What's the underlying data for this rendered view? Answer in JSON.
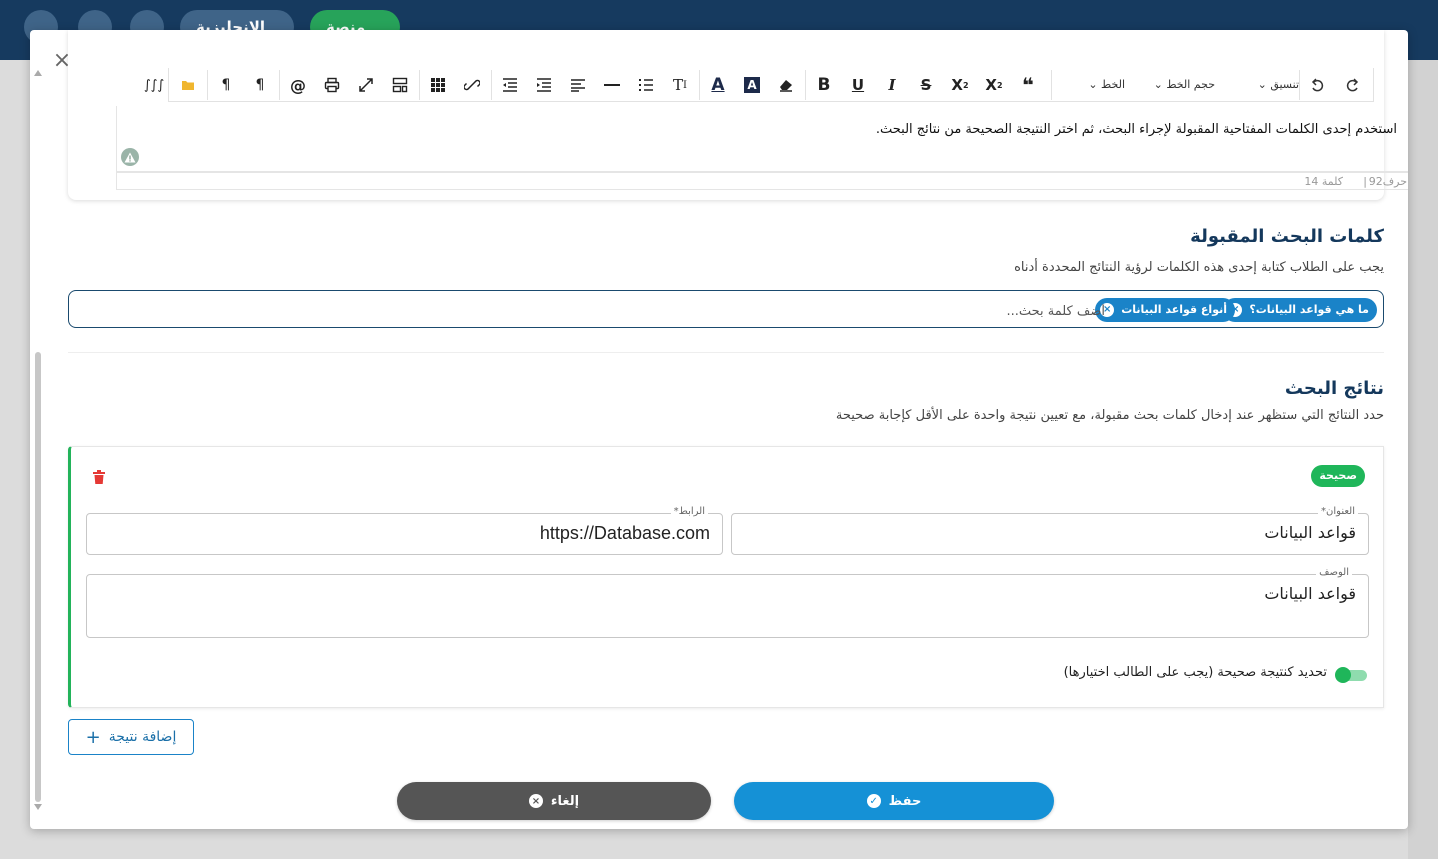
{
  "app": {
    "top_pills": [
      "الإنجليزية",
      "منصة"
    ]
  },
  "toolbar": {
    "format_label": "تنسيق",
    "font_size_label": "حجم الخط",
    "font_label": "الخط",
    "buttons": [
      "undo-icon",
      "redo-icon",
      "quote-icon",
      "superscript-icon",
      "subscript-icon",
      "strike-icon",
      "italic-icon",
      "underline-icon",
      "bold-icon",
      "eraser-icon",
      "bg-color-icon",
      "font-color-icon",
      "text-size-icon",
      "ordered-list-icon",
      "hr-icon",
      "align-icon",
      "outdent-icon",
      "indent-icon",
      "unlink-icon",
      "table-icon",
      "template-icon",
      "fullscreen-icon",
      "print-icon",
      "mention-icon",
      "rtl-icon",
      "ltr-icon",
      "folder-icon",
      "math-icon"
    ]
  },
  "editor": {
    "text": "استخدم إحدى الكلمات المفتاحية المقبولة لإجراء البحث، ثم اختر النتيجة الصحيحة من نتائج البحث.",
    "char_count": "حرف92",
    "separator": "|",
    "word_count": "كلمة 14"
  },
  "keywords": {
    "title": "كلمات البحث المقبولة",
    "description": "يجب على الطلاب كتابة إحدى هذه الكلمات لرؤية النتائج المحددة أدناه",
    "chips": [
      "ما هي قواعد البيانات؟",
      "أنواع قواعد البيانات"
    ],
    "chip_close": "×",
    "placeholder": "أضف كلمة بحث..."
  },
  "results": {
    "title": "نتائج البحث",
    "description": "حدد النتائج التي ستظهر عند إدخال كلمات بحث مقبولة، مع تعيين نتيجة واحدة على الأقل كإجابة صحيحة",
    "items": [
      {
        "badge": "صحيحة",
        "title_label": "العنوان*",
        "title_value": "قواعد البيانات",
        "link_label": "الرابط*",
        "link_value": "https://Database.com",
        "desc_label": "الوصف",
        "desc_value": "قواعد البيانات",
        "toggle_label": "تحديد كنتيجة صحيحة (يجب على الطالب اختيارها)",
        "is_correct": true
      }
    ],
    "add_label": "إضافة نتيجة",
    "add_symbol": "+"
  },
  "footer": {
    "save_label": "حفظ",
    "cancel_label": "إلغاء",
    "cancel_symbol": "×",
    "save_symbol": "✓"
  },
  "close_symbol": "×",
  "colors": {
    "primary": "#1591d6",
    "navy": "#14385c",
    "success": "#1fb65a",
    "danger": "#e53935"
  }
}
